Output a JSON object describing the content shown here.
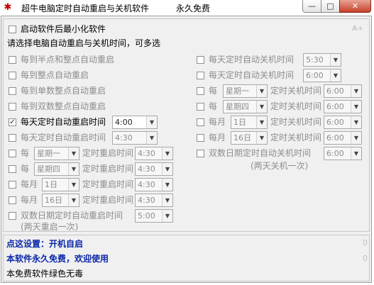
{
  "window": {
    "title": "超牛电脑定时自动重启与关机软件",
    "subtitle": "永久免费",
    "app_icon": "app-icon",
    "minimize": "—",
    "maximize": "□",
    "close": "✕"
  },
  "top": {
    "minimize_startup_label": "启动软件后最小化软件",
    "minimize_startup_checked": false,
    "instruction": "请选择电脑自动重启与关机时间，可多选",
    "font_hint": "A+"
  },
  "left_options": [
    {
      "label": "每到半点和整点自动重启",
      "checked": false,
      "enabled": false
    },
    {
      "label": "每到整点自动重启",
      "checked": false,
      "enabled": false
    },
    {
      "label": "每到单数整点自动重启",
      "checked": false,
      "enabled": false
    },
    {
      "label": "每到双数整点自动重启",
      "checked": false,
      "enabled": false
    },
    {
      "label": "每天定时自动重启时间",
      "checked": true,
      "enabled": true,
      "time": "4:00"
    },
    {
      "label": "每天定时自动重启时间",
      "checked": false,
      "enabled": false,
      "time": "4:30"
    },
    {
      "prefix": "每",
      "select1": "星期一",
      "label": "定时重启时间",
      "time": "4:30",
      "checked": false
    },
    {
      "prefix": "每",
      "select1": "星期四",
      "label": "定时重启时间",
      "time": "4:30",
      "checked": false
    },
    {
      "prefix": "每月",
      "select1": "1日",
      "label": "定时重启时间",
      "time": "4:30",
      "checked": false
    },
    {
      "prefix": "每月",
      "select1": "16日",
      "label": "定时重启时间",
      "time": "4:30",
      "checked": false
    },
    {
      "label": "双数日期定时自动重启时间",
      "time": "5:00",
      "note": "(两天重启一次)",
      "checked": false
    }
  ],
  "right_options": [
    {
      "label": "每天定时自动关机时间",
      "time": "5:30",
      "checked": false
    },
    {
      "label": "每天定时自动关机时间",
      "time": "6:00",
      "checked": false
    },
    {
      "prefix": "每",
      "select1": "星期一",
      "label": "定时关机时间",
      "time": "6:00",
      "checked": false
    },
    {
      "prefix": "每",
      "select1": "星期四",
      "label": "定时关机时间",
      "time": "6:00",
      "checked": false
    },
    {
      "prefix": "每月",
      "select1": "1日",
      "label": "定时关机时间",
      "time": "6:00",
      "checked": false
    },
    {
      "prefix": "每月",
      "select1": "16日",
      "label": "定时关机时间",
      "time": "6:00",
      "checked": false
    },
    {
      "label": "双数日期定时自动关机时间",
      "time": "6:00",
      "note": "(两天关机一次)",
      "checked": false
    }
  ],
  "bottom": {
    "settings_link": "点这设置：开机自启",
    "free_notice": "本软件永久免费，欢迎使用",
    "safe_notice": "本免费软件绿色无毒",
    "counter1": "0",
    "counter2": "0"
  },
  "colors": {
    "accent_blue": "#0a26a8",
    "disabled_gray": "#8d8d8d"
  }
}
